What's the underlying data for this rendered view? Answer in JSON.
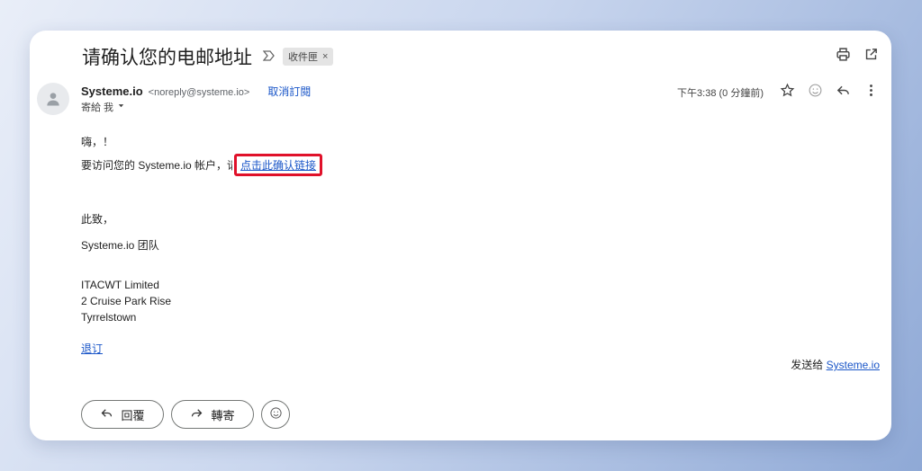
{
  "email": {
    "subject": "请确认您的电邮地址",
    "label_chip": "收件匣",
    "label_chip_close": "×",
    "sender_name": "Systeme.io",
    "sender_email": "<noreply@systeme.io>",
    "unsubscribe_top": "取消訂閱",
    "to_line": "寄給 我",
    "time": "下午3:38 (0 分鐘前)"
  },
  "body": {
    "greeting": "嗨，！",
    "access_prefix": "要访问您的 Systeme.io 帐户，",
    "access_hidden_char": "请",
    "confirm_link": "点击此确认链接",
    "closing": "此致，",
    "team": "Systeme.io 团队",
    "company": "ITACWT Limited",
    "address1": "2 Cruise Park Rise",
    "address2": "Tyrrelstown",
    "unsubscribe": "退订",
    "sent_to_prefix": "发送给 ",
    "sent_to_link": "Systeme.io"
  },
  "actions": {
    "reply": "回覆",
    "forward": "轉寄"
  },
  "icons": {
    "print": "print-icon",
    "open_new": "open-in-new-icon",
    "star": "star-icon",
    "emoji": "emoji-icon",
    "reply": "reply-icon",
    "more": "more-vert-icon",
    "forward": "forward-icon"
  },
  "colors": {
    "link": "#1a56c8",
    "highlight_border": "#e0112a"
  }
}
